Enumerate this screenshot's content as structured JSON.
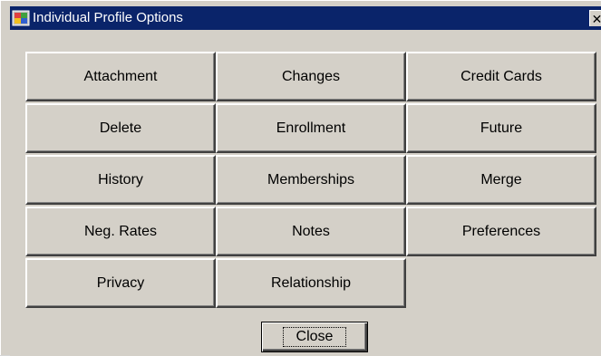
{
  "window": {
    "title": "Individual Profile Options",
    "title_icon": "app-icon",
    "close_glyph": "✕"
  },
  "buttons": [
    {
      "label": "Attachment",
      "name": "attachment-button"
    },
    {
      "label": "Changes",
      "name": "changes-button"
    },
    {
      "label": "Credit Cards",
      "name": "credit-cards-button"
    },
    {
      "label": "Delete",
      "name": "delete-button"
    },
    {
      "label": "Enrollment",
      "name": "enrollment-button"
    },
    {
      "label": "Future",
      "name": "future-button"
    },
    {
      "label": "History",
      "name": "history-button"
    },
    {
      "label": "Memberships",
      "name": "memberships-button"
    },
    {
      "label": "Merge",
      "name": "merge-button"
    },
    {
      "label": "Neg. Rates",
      "name": "neg-rates-button"
    },
    {
      "label": "Notes",
      "name": "notes-button"
    },
    {
      "label": "Preferences",
      "name": "preferences-button"
    },
    {
      "label": "Privacy",
      "name": "privacy-button"
    },
    {
      "label": "Relationship",
      "name": "relationship-button"
    }
  ],
  "footer": {
    "close_label": "Close"
  },
  "colors": {
    "titlebar": "#0a246a",
    "face": "#d4d0c8"
  }
}
